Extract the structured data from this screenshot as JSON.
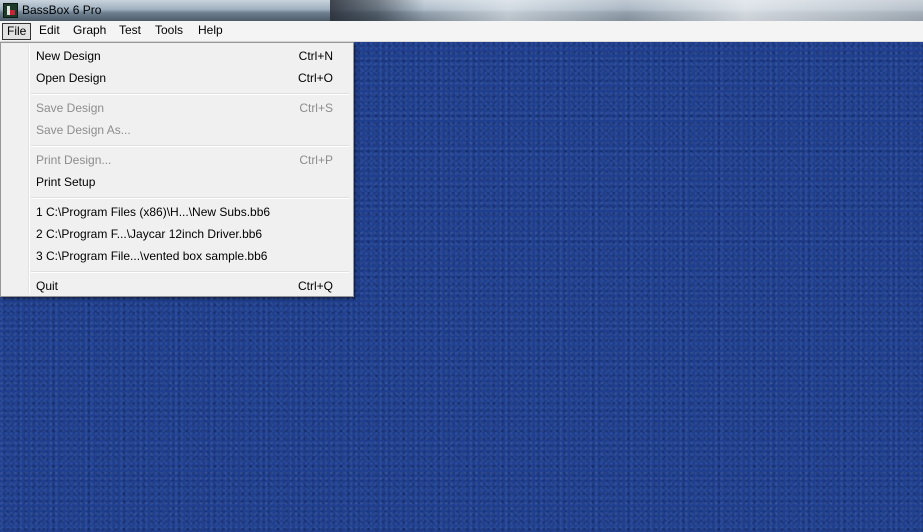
{
  "window": {
    "title": "BassBox 6 Pro",
    "icon": "bassbox-app-icon"
  },
  "menubar": {
    "items": [
      {
        "label": "File",
        "active": true
      },
      {
        "label": "Edit"
      },
      {
        "label": "Graph"
      },
      {
        "label": "Test"
      },
      {
        "label": "Tools"
      },
      {
        "label": "Help"
      }
    ]
  },
  "file_menu": {
    "items": [
      {
        "label": "New Design",
        "shortcut": "Ctrl+N",
        "enabled": true
      },
      {
        "label": "Open Design",
        "shortcut": "Ctrl+O",
        "enabled": true
      },
      {
        "label": "Save Design",
        "shortcut": "Ctrl+S",
        "enabled": false
      },
      {
        "label": "Save Design As...",
        "shortcut": "",
        "enabled": false
      },
      {
        "label": "Print Design...",
        "shortcut": "Ctrl+P",
        "enabled": false
      },
      {
        "label": "Print Setup",
        "shortcut": "",
        "enabled": true
      },
      {
        "label": "1 C:\\Program Files (x86)\\H...\\New Subs.bb6",
        "shortcut": "",
        "enabled": true
      },
      {
        "label": "2 C:\\Program F...\\Jaycar 12inch Driver.bb6",
        "shortcut": "",
        "enabled": true
      },
      {
        "label": "3 C:\\Program File...\\vented box sample.bb6",
        "shortcut": "",
        "enabled": true
      },
      {
        "label": "Quit",
        "shortcut": "Ctrl+Q",
        "enabled": true
      }
    ]
  },
  "colors": {
    "workspace_background": "#1f3f8e",
    "menu_background": "#f0f0f0",
    "disabled_text": "#8d8d8d"
  }
}
